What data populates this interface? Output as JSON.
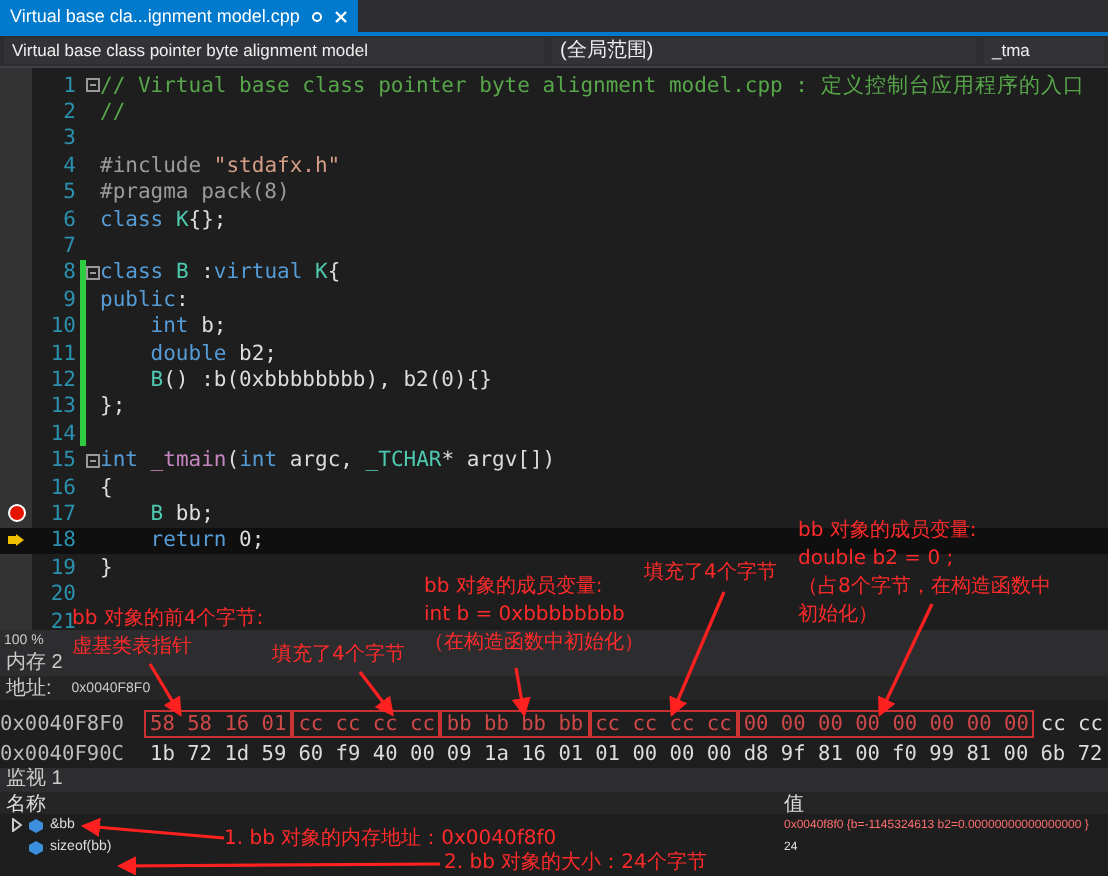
{
  "tab": {
    "title": "Virtual base cla...ignment model.cpp",
    "selected": true
  },
  "nav": {
    "project": "Virtual base class pointer byte alignment model",
    "scope": "(全局范围)",
    "member": "_tma"
  },
  "code": {
    "lines": [
      {
        "n": "1",
        "fold": true,
        "changed": false,
        "current": false,
        "tokens": [
          {
            "kind": "com",
            "t": "// Virtual base class pointer byte alignment model.cpp : 定义控制台应用程序的入口"
          }
        ]
      },
      {
        "n": "2",
        "fold": false,
        "changed": false,
        "current": false,
        "tokens": [
          {
            "kind": "com",
            "t": "//"
          }
        ]
      },
      {
        "n": "3",
        "fold": false,
        "changed": false,
        "current": false
      },
      {
        "n": "4",
        "fold": false,
        "changed": false,
        "current": false,
        "tokens": [
          {
            "kind": "pre",
            "t": "#include "
          },
          {
            "kind": "str",
            "t": "\"stdafx.h\""
          }
        ]
      },
      {
        "n": "5",
        "fold": false,
        "changed": false,
        "current": false,
        "tokens": [
          {
            "kind": "pre",
            "t": "#pragma pack(8)"
          }
        ]
      },
      {
        "n": "6",
        "fold": false,
        "changed": false,
        "current": false,
        "tokens": [
          {
            "kind": "kw",
            "t": "class "
          },
          {
            "kind": "type",
            "t": "K"
          },
          {
            "kind": "plain",
            "t": "{};"
          }
        ]
      },
      {
        "n": "7",
        "fold": false,
        "changed": false,
        "current": false
      },
      {
        "n": "8",
        "fold": true,
        "changed": true,
        "current": false,
        "tokens": [
          {
            "kind": "kw",
            "t": "class "
          },
          {
            "kind": "type",
            "t": "B"
          },
          {
            "kind": "plain",
            "t": " :"
          },
          {
            "kind": "kw",
            "t": "virtual "
          },
          {
            "kind": "type",
            "t": "K"
          },
          {
            "kind": "plain",
            "t": "{"
          }
        ]
      },
      {
        "n": "9",
        "fold": false,
        "changed": true,
        "current": false,
        "tokens": [
          {
            "kind": "kw",
            "t": "public"
          },
          {
            "kind": "plain",
            "t": ":"
          }
        ]
      },
      {
        "n": "10",
        "fold": false,
        "changed": true,
        "current": false,
        "tokens": [
          {
            "kind": "kw",
            "t": "    int"
          },
          {
            "kind": "plain",
            "t": " b;"
          }
        ]
      },
      {
        "n": "11",
        "fold": false,
        "changed": true,
        "current": false,
        "tokens": [
          {
            "kind": "kw",
            "t": "    double"
          },
          {
            "kind": "plain",
            "t": " b2;"
          }
        ]
      },
      {
        "n": "12",
        "fold": false,
        "changed": true,
        "current": false,
        "tokens": [
          {
            "kind": "type",
            "t": "    B"
          },
          {
            "kind": "plain",
            "t": "() :b(0xbbbbbbbb), b2(0){}"
          }
        ]
      },
      {
        "n": "13",
        "fold": false,
        "changed": true,
        "current": false,
        "tokens": [
          {
            "kind": "plain",
            "t": "};"
          }
        ]
      },
      {
        "n": "14",
        "fold": false,
        "changed": true,
        "current": false
      },
      {
        "n": "15",
        "fold": true,
        "changed": false,
        "current": false,
        "tokens": [
          {
            "kind": "kw",
            "t": "int "
          },
          {
            "kind": "fn",
            "t": "_tmain"
          },
          {
            "kind": "plain",
            "t": "("
          },
          {
            "kind": "kw",
            "t": "int"
          },
          {
            "kind": "plain",
            "t": " argc, "
          },
          {
            "kind": "type",
            "t": "_TCHAR"
          },
          {
            "kind": "plain",
            "t": "* argv[])"
          }
        ]
      },
      {
        "n": "16",
        "fold": false,
        "changed": false,
        "current": false,
        "tokens": [
          {
            "kind": "plain",
            "t": "{"
          }
        ]
      },
      {
        "n": "17",
        "fold": false,
        "changed": false,
        "current": false,
        "gutter": {
          "kind": "breakpoint"
        },
        "tokens": [
          {
            "kind": "type",
            "t": "    B"
          },
          {
            "kind": "plain",
            "t": " bb;"
          }
        ]
      },
      {
        "n": "18",
        "fold": false,
        "changed": false,
        "current": true,
        "gutter": {
          "kind": "next"
        },
        "tokens": [
          {
            "kind": "kw",
            "t": "    return"
          },
          {
            "kind": "plain",
            "t": " 0;"
          }
        ]
      },
      {
        "n": "19",
        "fold": false,
        "changed": false,
        "current": false,
        "tokens": [
          {
            "kind": "plain",
            "t": "}"
          }
        ]
      },
      {
        "n": "20",
        "fold": false,
        "changed": false,
        "current": false
      },
      {
        "n": "21",
        "fold": false,
        "changed": false,
        "current": false
      }
    ]
  },
  "zoom": "100 %",
  "memory": {
    "title": "内存 2",
    "address_label": "地址:",
    "address": "0x0040F8F0",
    "rows": [
      {
        "address": "0x0040F8F0",
        "groups": [
          {
            "bytes": "58 58 16 01",
            "boxed": true
          },
          {
            "bytes": "cc cc cc cc",
            "boxed": true
          },
          {
            "bytes": "bb bb bb bb",
            "boxed": true
          },
          {
            "bytes": "cc cc cc cc",
            "boxed": true
          },
          {
            "bytes": "00 00 00 00 00 00 00 00",
            "boxed": true
          },
          {
            "bytes": "cc cc",
            "boxed": false
          }
        ]
      },
      {
        "address": "0x0040F90C",
        "groups": [
          {
            "bytes": "1b 72 1d 59",
            "boxed": false
          },
          {
            "bytes": "60 f9 40 00",
            "boxed": false
          },
          {
            "bytes": "09 1a 16 01",
            "boxed": false
          },
          {
            "bytes": "01 00 00 00",
            "boxed": false
          },
          {
            "bytes": "d8 9f 81 00",
            "boxed": false
          },
          {
            "bytes": "f0 99 81 00",
            "boxed": false
          },
          {
            "bytes": "6b 72",
            "boxed": false
          }
        ]
      }
    ]
  },
  "watch": {
    "title": "监视 1",
    "columns": [
      "名称",
      "值"
    ],
    "rows": [
      {
        "name": "&bb",
        "value": "0x0040f8f0 {b=-1145324613 b2=0.00000000000000000 }",
        "expandable": true,
        "changed": true
      },
      {
        "name": "sizeof(bb)",
        "value": "24",
        "expandable": false,
        "changed": false
      }
    ]
  },
  "annotations": [
    {
      "lines": [
        "bb 对象的前4个字节:",
        "虚基类表指针"
      ]
    },
    {
      "lines": [
        "填充了4个字节"
      ]
    },
    {
      "lines": [
        "bb 对象的成员变量:",
        "int b = 0xbbbbbbbb",
        "（在构造函数中初始化）"
      ]
    },
    {
      "lines": [
        "填充了4个字节"
      ]
    },
    {
      "lines": [
        "bb 对象的成员变量:",
        "double b2 = 0 ;",
        "（占8个字节，在构造函数中",
        "初始化）"
      ]
    },
    {
      "lines": [
        "1. bb 对象的内存地址：0x0040f8f0"
      ]
    },
    {
      "lines": [
        "2. bb 对象的大小：24个字节"
      ]
    }
  ]
}
